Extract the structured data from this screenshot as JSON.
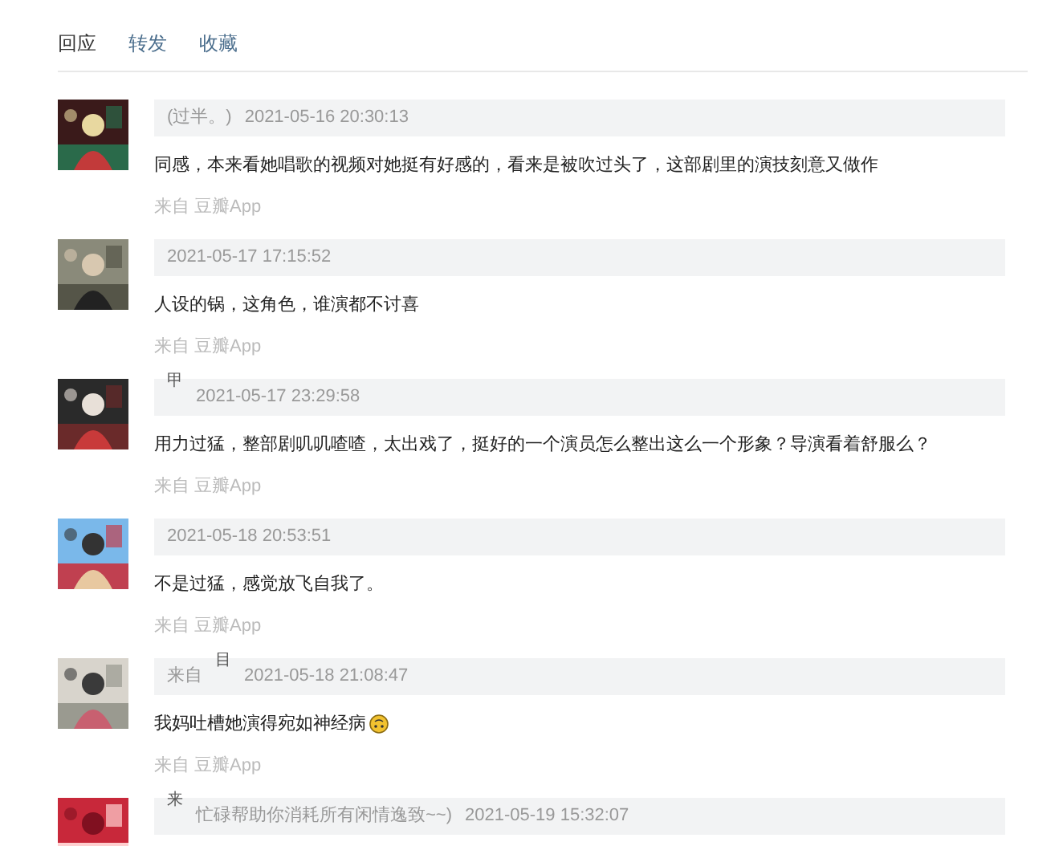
{
  "tabs": [
    {
      "label": "回应",
      "selected": true
    },
    {
      "label": "转发",
      "selected": false
    },
    {
      "label": "收藏",
      "selected": false
    }
  ],
  "comments": [
    {
      "avatar": {
        "kind": "picture"
      },
      "name_parts": [
        {
          "text": "(过半。)",
          "raised": false
        }
      ],
      "time": "2021-05-16 20:30:13",
      "body": "同感，本来看她唱歌的视频对她挺有好感的，看来是被吹过头了，这部剧里的演技刻意又做作",
      "source": "来自 豆瓣App"
    },
    {
      "avatar": {
        "kind": "picture"
      },
      "time": "2021-05-17 17:15:52",
      "body": "人设的锅，这角色，谁演都不讨喜",
      "source": "来自 豆瓣App"
    },
    {
      "avatar": {
        "kind": "picture"
      },
      "name_parts": [
        {
          "text": "甲",
          "raised": true
        }
      ],
      "time": "2021-05-17 23:29:58",
      "body": "用力过猛，整部剧叽叽喳喳，太出戏了，挺好的一个演员怎么整出这么一个形象？导演看着舒服么？",
      "source": "来自 豆瓣App"
    },
    {
      "avatar": {
        "kind": "picture"
      },
      "time": "2021-05-18 20:53:51",
      "body": "不是过猛，感觉放飞自我了。",
      "source": "来自 豆瓣App"
    },
    {
      "avatar": {
        "kind": "picture"
      },
      "name_parts": [
        {
          "text": "来自",
          "raised": false
        },
        {
          "text": "目",
          "raised": true
        }
      ],
      "time": "2021-05-18 21:08:47",
      "body": "我妈吐槽她演得宛如神经病",
      "emoji": true,
      "source": "来自 豆瓣App"
    },
    {
      "avatar": {
        "kind": "picture"
      },
      "name_parts": [
        {
          "text": "来",
          "raised": true
        },
        {
          "text": "忙碌帮助你消耗所有闲情逸致~~)",
          "raised": false
        }
      ],
      "time": "2021-05-19 15:32:07"
    }
  ]
}
